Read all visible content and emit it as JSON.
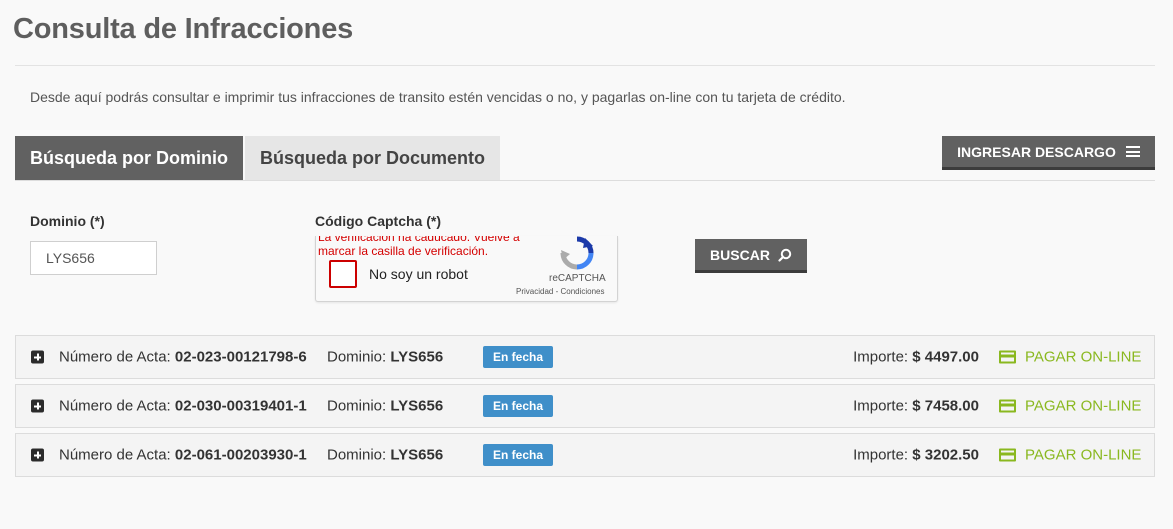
{
  "page": {
    "title": "Consulta de Infracciones",
    "intro": "Desde aquí podrás consultar e imprimir tus infracciones de transito estén vencidas o no, y pagarlas on-line con tu tarjeta de crédito."
  },
  "tabs": [
    {
      "label": "Búsqueda por Dominio",
      "active": true
    },
    {
      "label": "Búsqueda por Documento",
      "active": false
    }
  ],
  "actions": {
    "descargo_label": "INGRESAR DESCARGO",
    "buscar_label": "BUSCAR"
  },
  "form": {
    "dominio_label": "Dominio (*)",
    "dominio_value": "LYS656",
    "captcha_label": "Código Captcha (*)",
    "captcha_error": "La verificación ha caducado. Vuelve a marcar la casilla de verificación.",
    "captcha_checkbox_text": "No soy un robot",
    "captcha_brand": "reCAPTCHA",
    "captcha_links": "Privacidad - Condiciones"
  },
  "results": {
    "acta_label": "Número de Acta:",
    "dominio_label": "Dominio:",
    "importe_label": "Importe:",
    "pay_label": "PAGAR ON-LINE",
    "rows": [
      {
        "acta": "02-023-00121798-6",
        "dominio": "LYS656",
        "estado": "En fecha",
        "importe": "$ 4497.00"
      },
      {
        "acta": "02-030-00319401-1",
        "dominio": "LYS656",
        "estado": "En fecha",
        "importe": "$ 7458.00"
      },
      {
        "acta": "02-061-00203930-1",
        "dominio": "LYS656",
        "estado": "En fecha",
        "importe": "$ 3202.50"
      }
    ]
  },
  "colors": {
    "tab_active": "#616161",
    "badge": "#3f8fc9",
    "pay": "#8ab81f",
    "error": "#d40000"
  }
}
